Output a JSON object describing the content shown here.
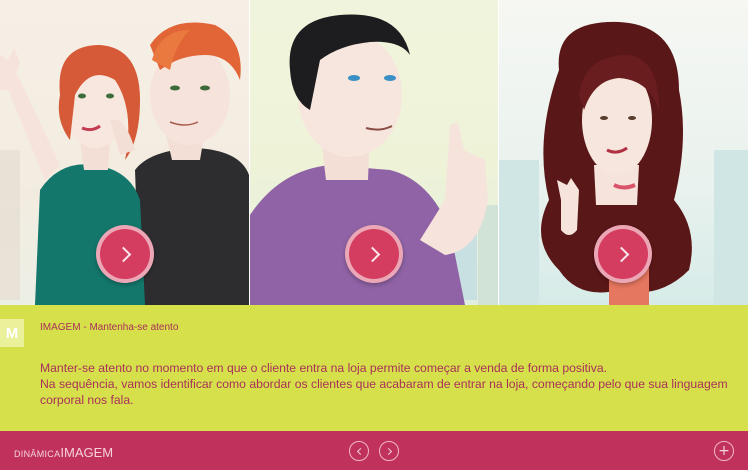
{
  "info": {
    "badge": "M",
    "title": "IMAGEM - Mantenha-se atento",
    "paragraph_1": "Manter-se atento no momento em que o cliente entra na loja permite começar a venda de forma positiva.",
    "paragraph_2": "Na sequência, vamos identificar como abordar os clientes que acabaram de entrar na loja, começando pelo que sua linguagem corporal nos fala."
  },
  "footer": {
    "label_small": "DINÂMICA",
    "label_big": "IMAGEM",
    "plus": "+"
  },
  "colors": {
    "accent": "#c0325c",
    "panel": "#d6e04a",
    "text": "#a8315a",
    "play_button": "#d43d5f"
  },
  "icons": {
    "play": "chevron-right-icon",
    "prev": "chevron-left-icon",
    "next": "chevron-right-icon",
    "more": "plus-icon"
  }
}
